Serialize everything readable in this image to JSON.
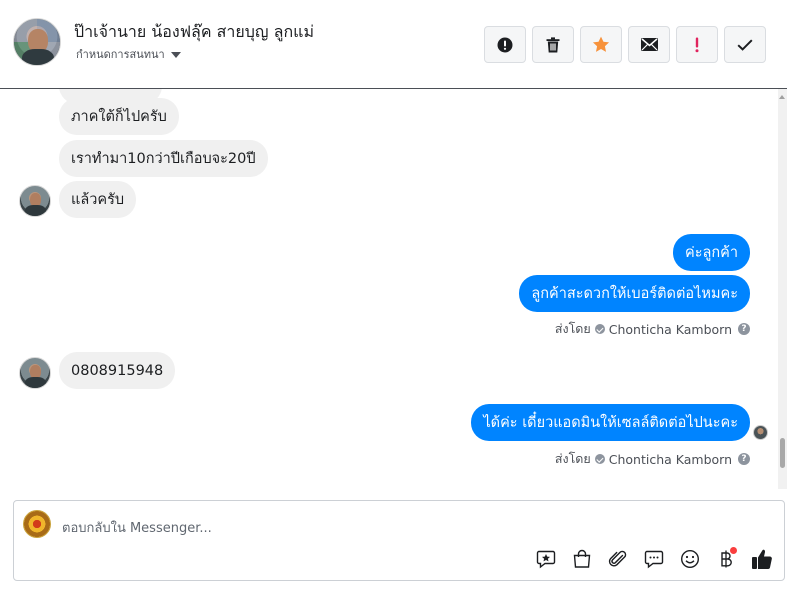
{
  "header": {
    "contact_name": "ป๊าเจ้านาย น้องฟลุ๊ค สายบุญ ลูกแม่",
    "assign_label": "กำหนดการสนทนา",
    "actions": [
      {
        "name": "spam",
        "icon": "exclamation-circle-icon"
      },
      {
        "name": "delete",
        "icon": "trash-icon"
      },
      {
        "name": "star",
        "icon": "star-icon",
        "color": "#f7923b"
      },
      {
        "name": "mark-unread",
        "icon": "envelope-icon"
      },
      {
        "name": "important",
        "icon": "red-exclamation-icon",
        "color": "#e0245e"
      },
      {
        "name": "mark-done",
        "icon": "checkmark-icon"
      }
    ]
  },
  "messages": {
    "in_1": "ภาคใต้ก็ไปครับ",
    "in_2": "เราทำมา10กว่าปีเกือบจะ20ปี",
    "in_3": "แล้วครับ",
    "out_1": "ค่ะลูกค้า",
    "out_2": "ลูกค้าสะดวกให้เบอร์ติดต่อไหมคะ",
    "in_4": "0808915948",
    "out_3": "ได้ค่ะ เดี๋ยวแอดมินให้เซลล์ติดต่อไปนะคะ"
  },
  "sent_by": {
    "prefix": "ส่งโดย",
    "name": "Chonticha Kamborn",
    "help": "?"
  },
  "composer": {
    "placeholder": "ตอบกลับใน Messenger...",
    "tools": [
      "saved-reply-icon",
      "shop-bag-icon",
      "attachment-icon",
      "chat-bubble-icon",
      "emoji-icon",
      "baht-payment-icon",
      "thumbs-up-icon"
    ]
  },
  "colors": {
    "outgoing_bubble": "#0084ff",
    "incoming_bubble": "#f0f0f0",
    "star": "#f7923b",
    "important": "#e0245e"
  }
}
